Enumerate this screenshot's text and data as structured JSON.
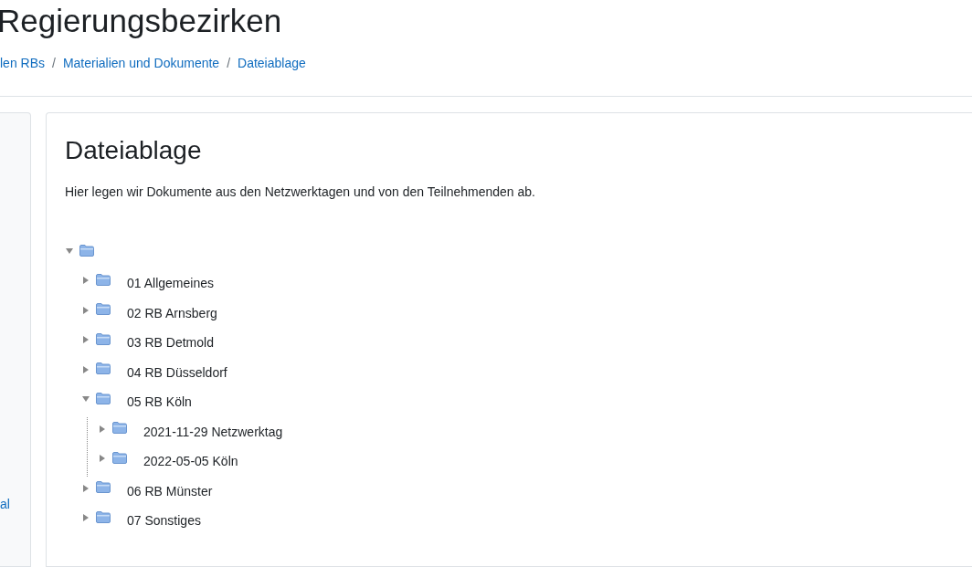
{
  "page_title": "Regierungsbezirken",
  "breadcrumb": {
    "separator": "/",
    "items": [
      "len RBs",
      "Materialien und Dokumente",
      "Dateiablage"
    ]
  },
  "sidebar": {
    "link": "al"
  },
  "content": {
    "title": "Dateiablage",
    "description": "Hier legen wir Dokumente aus den Netzwerktagen und von den Teilnehmenden ab.",
    "tree": {
      "expanded": true,
      "children": [
        {
          "name": "01 Allgemeines",
          "expanded": false
        },
        {
          "name": "02 RB Arnsberg",
          "expanded": false
        },
        {
          "name": "03 RB Detmold",
          "expanded": false
        },
        {
          "name": "04 RB Düsseldorf",
          "expanded": false
        },
        {
          "name": "05 RB Köln",
          "expanded": true,
          "children": [
            {
              "name": "2021-11-29 Netzwerktag",
              "expanded": false
            },
            {
              "name": "2022-05-05 Köln",
              "expanded": false
            }
          ]
        },
        {
          "name": "06 RB Münster",
          "expanded": false
        },
        {
          "name": "07 Sonstiges",
          "expanded": false
        }
      ]
    }
  }
}
